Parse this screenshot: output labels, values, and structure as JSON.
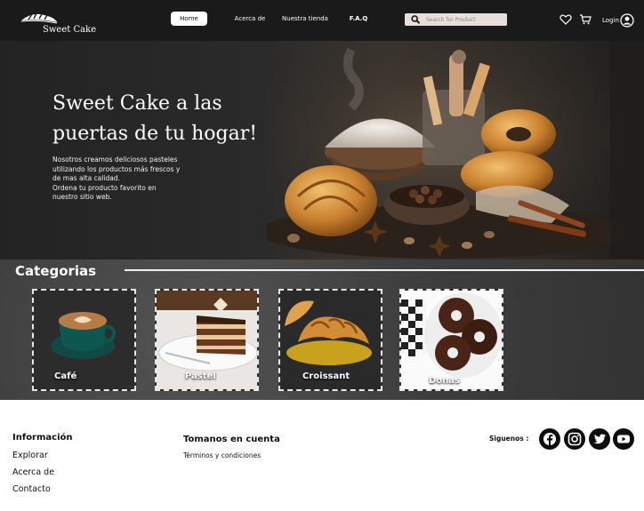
{
  "header": {
    "brand": "Sweet Cake",
    "nav": {
      "home": "Home",
      "about": "Acerca de",
      "store": "Nuestra tienda",
      "faq": "F.A.Q"
    },
    "search_placeholder": "Search for Product",
    "login_label": "Login",
    "icons": [
      "search-icon",
      "heart-icon",
      "cart-icon",
      "user-icon"
    ]
  },
  "hero": {
    "title": "Sweet Cake a las puertas de tu hogar!",
    "line1": "Nosotros creamos deliciosos pasteles",
    "line2": "utilizando los productos más frescos y",
    "line3": "de mas alta calidad.",
    "line4": "Ordena tu producto favorito en",
    "line5": "nuestro sitio web."
  },
  "categories": {
    "title": "Categorias",
    "items": [
      {
        "label": "Café"
      },
      {
        "label": "Pastel"
      },
      {
        "label": "Croissant"
      },
      {
        "label": "Donas"
      }
    ]
  },
  "footer": {
    "info": {
      "heading": "Información",
      "links": [
        "Explorar",
        "Acerca de",
        "Contacto"
      ]
    },
    "terms": {
      "heading": "Tomanos en cuenta",
      "link": "Términos y condiciones"
    },
    "follow_label": "Siguenos :",
    "social": [
      "facebook-icon",
      "instagram-icon",
      "twitter-icon",
      "youtube-icon"
    ]
  },
  "colors": {
    "header_bg": "#1a1a1a",
    "categories_bg": "#3e3e3e",
    "search_bg": "#e8dede",
    "social_bg": "#0d0d0d"
  }
}
